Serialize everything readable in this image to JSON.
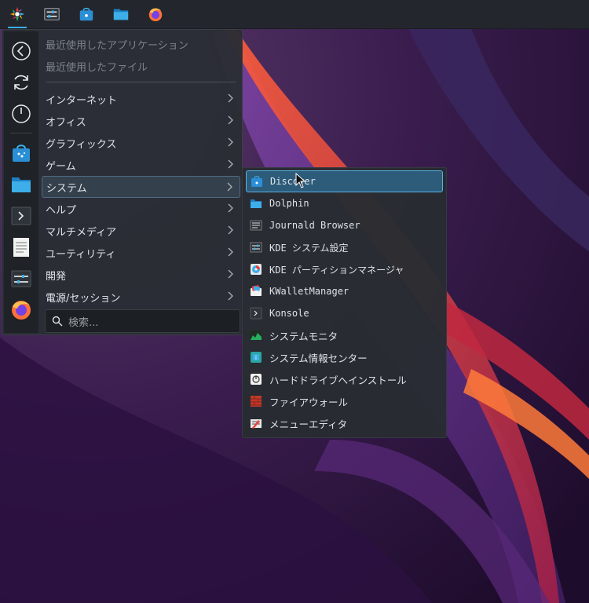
{
  "taskbar": {
    "items": [
      {
        "icon": "app-launcher-icon",
        "active": true
      },
      {
        "icon": "system-settings-icon",
        "active": false
      },
      {
        "icon": "discover-store-icon",
        "active": false
      },
      {
        "icon": "dolphin-folder-icon",
        "active": false
      },
      {
        "icon": "firefox-icon",
        "active": false
      }
    ]
  },
  "sidebar": {
    "buttons": [
      {
        "icon": "back-arrow-icon"
      },
      {
        "icon": "refresh-icon"
      },
      {
        "icon": "power-icon"
      },
      {
        "icon": "discover-store-icon"
      },
      {
        "icon": "folder-icon"
      },
      {
        "icon": "terminal-icon"
      },
      {
        "icon": "text-document-icon"
      },
      {
        "icon": "sliders-settings-icon"
      },
      {
        "icon": "firefox-icon"
      }
    ]
  },
  "menu": {
    "recent": [
      {
        "label": "最近使用したアプリケーション"
      },
      {
        "label": "最近使用したファイル"
      }
    ],
    "categories": [
      {
        "label": "インターネット"
      },
      {
        "label": "オフィス"
      },
      {
        "label": "グラフィックス"
      },
      {
        "label": "ゲーム"
      },
      {
        "label": "システム",
        "selected": true
      },
      {
        "label": "ヘルプ"
      },
      {
        "label": "マルチメディア"
      },
      {
        "label": "ユーティリティ"
      },
      {
        "label": "開発"
      },
      {
        "label": "電源/セッション"
      }
    ]
  },
  "search": {
    "placeholder": "検索..."
  },
  "submenu": {
    "items": [
      {
        "label": "Discover",
        "icon": "discover-icon",
        "highlight": true
      },
      {
        "label": "Dolphin",
        "icon": "dolphin-icon"
      },
      {
        "label": "Journald Browser",
        "icon": "journal-icon"
      },
      {
        "label": "KDE システム設定",
        "icon": "settings-icon"
      },
      {
        "label": "KDE パーティションマネージャ",
        "icon": "partition-icon"
      },
      {
        "label": "KWalletManager",
        "icon": "wallet-icon"
      },
      {
        "label": "Konsole",
        "icon": "konsole-icon"
      },
      {
        "label": "システムモニタ",
        "icon": "system-monitor-icon"
      },
      {
        "label": "システム情報センター",
        "icon": "info-center-icon"
      },
      {
        "label": "ハードドライブへインストール",
        "icon": "installer-icon"
      },
      {
        "label": "ファイアウォール",
        "icon": "firewall-icon"
      },
      {
        "label": "メニューエディタ",
        "icon": "menu-editor-icon"
      }
    ]
  },
  "colors": {
    "accent": "#3daee9",
    "panel": "#23272d",
    "menu_bg": "#2a2e34"
  }
}
